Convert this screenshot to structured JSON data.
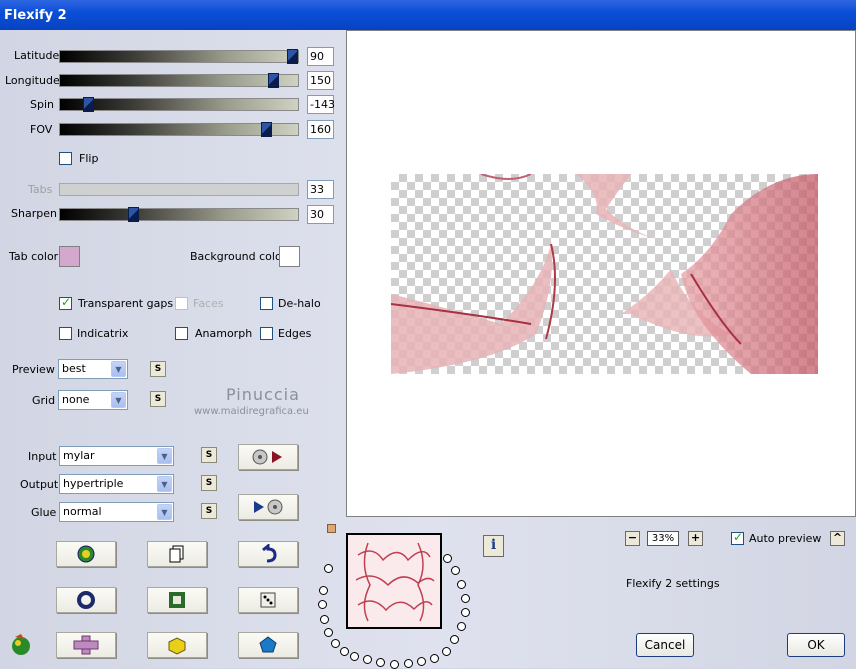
{
  "window": {
    "title": "Flexify 2"
  },
  "sliders": [
    {
      "label": "Latitude",
      "value": "90",
      "fraction": 0.96
    },
    {
      "label": "Longitude",
      "value": "150",
      "fraction": 0.91
    },
    {
      "label": "Spin",
      "value": "-143",
      "fraction": 0.11
    },
    {
      "label": "FOV",
      "value": "160",
      "fraction": 0.88
    },
    {
      "label": "Tabs",
      "value": "33",
      "fraction": null
    },
    {
      "label": "Sharpen",
      "value": "30",
      "fraction": 0.3
    }
  ],
  "flip": {
    "label": "Flip",
    "checked": false
  },
  "colors": {
    "tab_color_label": "Tab color",
    "tab_color": "#d4a8cc",
    "background_color_label": "Background color",
    "background_color": "#ffffff"
  },
  "options": {
    "transparent_gaps": {
      "label": "Transparent gaps",
      "checked": true
    },
    "faces": {
      "label": "Faces",
      "checked": false,
      "disabled": true
    },
    "de_halo": {
      "label": "De-halo",
      "checked": false
    },
    "indicatrix": {
      "label": "Indicatrix",
      "checked": false
    },
    "anamorph": {
      "label": "Anamorph",
      "checked": false
    },
    "edges": {
      "label": "Edges",
      "checked": false
    }
  },
  "preview_select": {
    "label": "Preview",
    "value": "best"
  },
  "grid_select": {
    "label": "Grid",
    "value": "none"
  },
  "watermark": {
    "name": "Pinuccia",
    "site": "www.maidiregrafica.eu"
  },
  "input_select": {
    "label": "Input",
    "value": "mylar"
  },
  "output_select": {
    "label": "Output",
    "value": "hypertriple"
  },
  "glue_select": {
    "label": "Glue",
    "value": "normal"
  },
  "s_button_label": "S",
  "zoom": {
    "value": "33%",
    "minus": "−",
    "plus": "+"
  },
  "auto_preview": {
    "label": "Auto preview",
    "checked": true,
    "button": "^"
  },
  "settings_label": "Flexify 2 settings",
  "info_button": "i",
  "cancel_label": "Cancel",
  "ok_label": "OK",
  "accent": {
    "checker": "#cfcfcf",
    "pink": "#d98a90"
  }
}
